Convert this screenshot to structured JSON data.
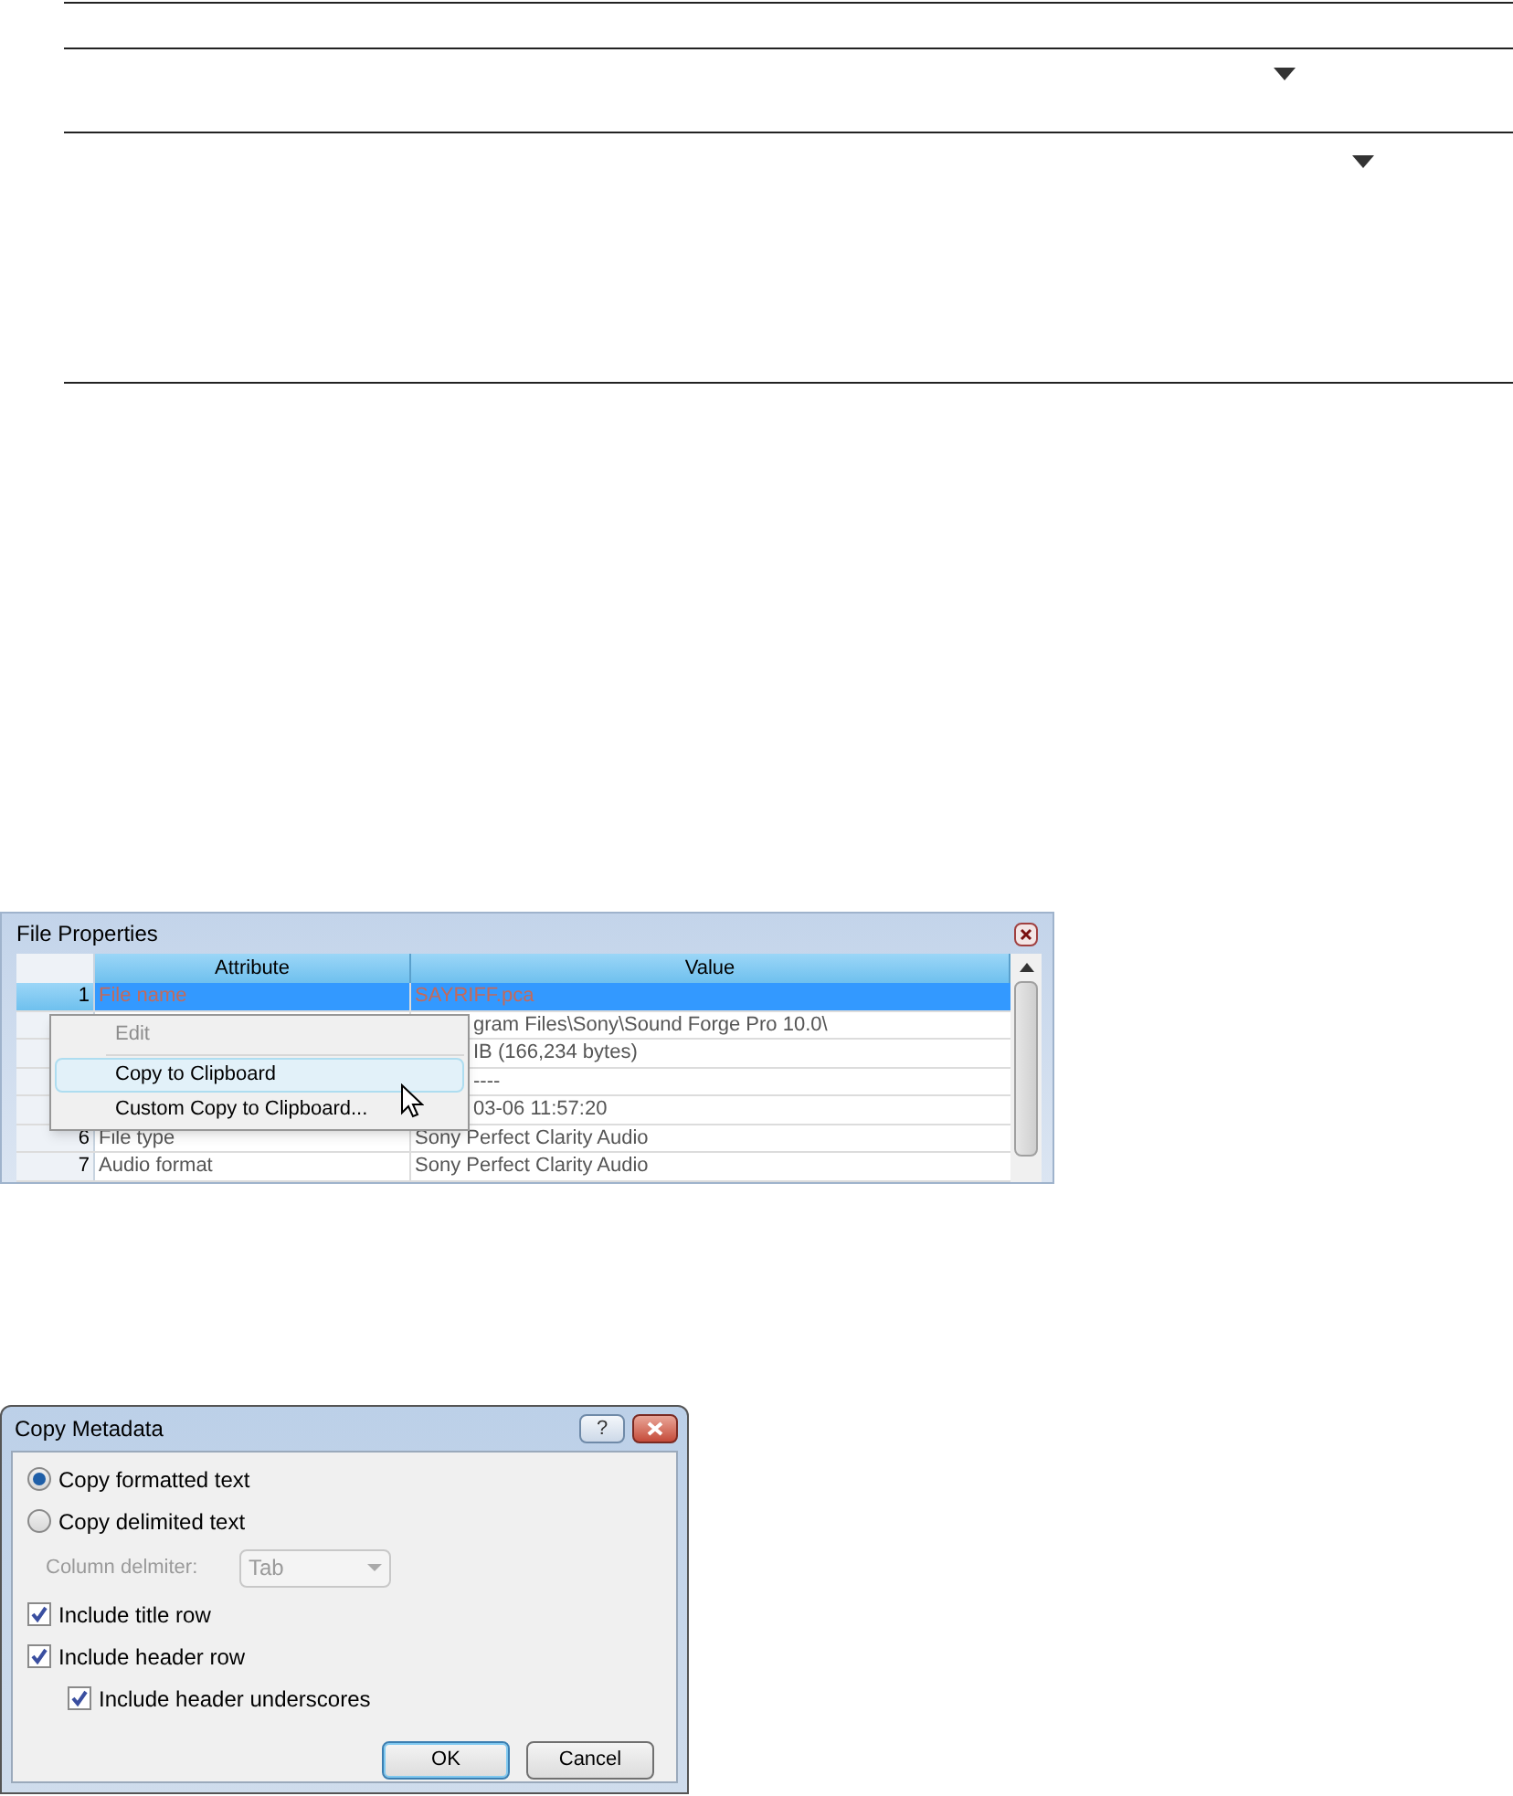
{
  "file_properties": {
    "title": "File Properties",
    "columns": [
      "Attribute",
      "Value"
    ],
    "rows": [
      {
        "number": "1",
        "attribute": "File name",
        "value": "SAYRIFF.pca",
        "selected": true
      },
      {
        "value": "gram Files\\Sony\\Sound Forge Pro 10.0\\",
        "selected": false
      },
      {
        "value": "IB (166,234 bytes)",
        "selected": false
      },
      {
        "value": "----",
        "selected": false
      },
      {
        "value": "03-06  11:57:20",
        "selected": false
      },
      {
        "number": "6",
        "attribute": "File type",
        "value": "Sony Perfect Clarity Audio",
        "selected": false
      },
      {
        "number": "7",
        "attribute": "Audio format",
        "value": "Sony Perfect Clarity Audio",
        "selected": false
      }
    ],
    "context_menu": [
      {
        "kind": "item",
        "label": "Edit",
        "disabled": true,
        "selected": false
      },
      {
        "kind": "separator"
      },
      {
        "kind": "item",
        "label": "Copy to Clipboard",
        "disabled": false,
        "selected": true
      },
      {
        "kind": "item",
        "label": "Custom Copy to Clipboard...",
        "disabled": false,
        "selected": false
      }
    ]
  },
  "copy_metadata": {
    "title": "Copy Metadata",
    "help_button": "?",
    "options": [
      {
        "kind": "radio",
        "label": "Copy formatted text",
        "selected": true
      },
      {
        "kind": "radio",
        "label": "Copy delimited text",
        "selected": false
      },
      {
        "kind": "select",
        "label": "Column delmiter:",
        "value": "Tab",
        "disabled": true
      },
      {
        "kind": "checkbox",
        "label": "Include title row",
        "checked": true
      },
      {
        "kind": "checkbox",
        "label": "Include header row",
        "checked": true,
        "children": [
          {
            "kind": "checkbox",
            "label": "Include header underscores",
            "checked": true
          }
        ]
      }
    ],
    "buttons": [
      {
        "label": "OK",
        "default": true
      },
      {
        "label": "Cancel",
        "default": false
      }
    ]
  }
}
